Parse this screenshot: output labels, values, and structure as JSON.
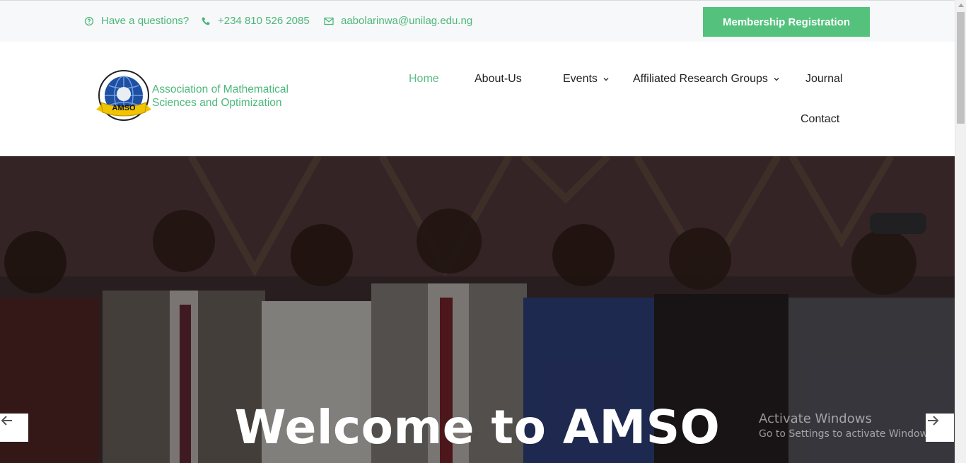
{
  "topbar": {
    "question": "Have a questions?",
    "phone": "+234 810 526 2085",
    "email": "aabolarinwa@unilag.edu.ng",
    "register_label": "Membership Registration"
  },
  "header": {
    "brand_line1": "Association of Mathematical",
    "brand_line2": "Sciences and Optimization",
    "logo_text": "AMSO"
  },
  "nav": {
    "home": "Home",
    "about": "About-Us",
    "events": "Events",
    "groups": "Affiliated Research Groups",
    "journal": "Journal",
    "contact": "Contact"
  },
  "hero": {
    "title": "Welcome to AMSO"
  },
  "watermark": {
    "title": "Activate Windows",
    "subtitle": "Go to Settings to activate Windows."
  },
  "colors": {
    "accent": "#4cb77b",
    "button": "#54c27c",
    "hero_overlay": "#2e2a2b"
  }
}
